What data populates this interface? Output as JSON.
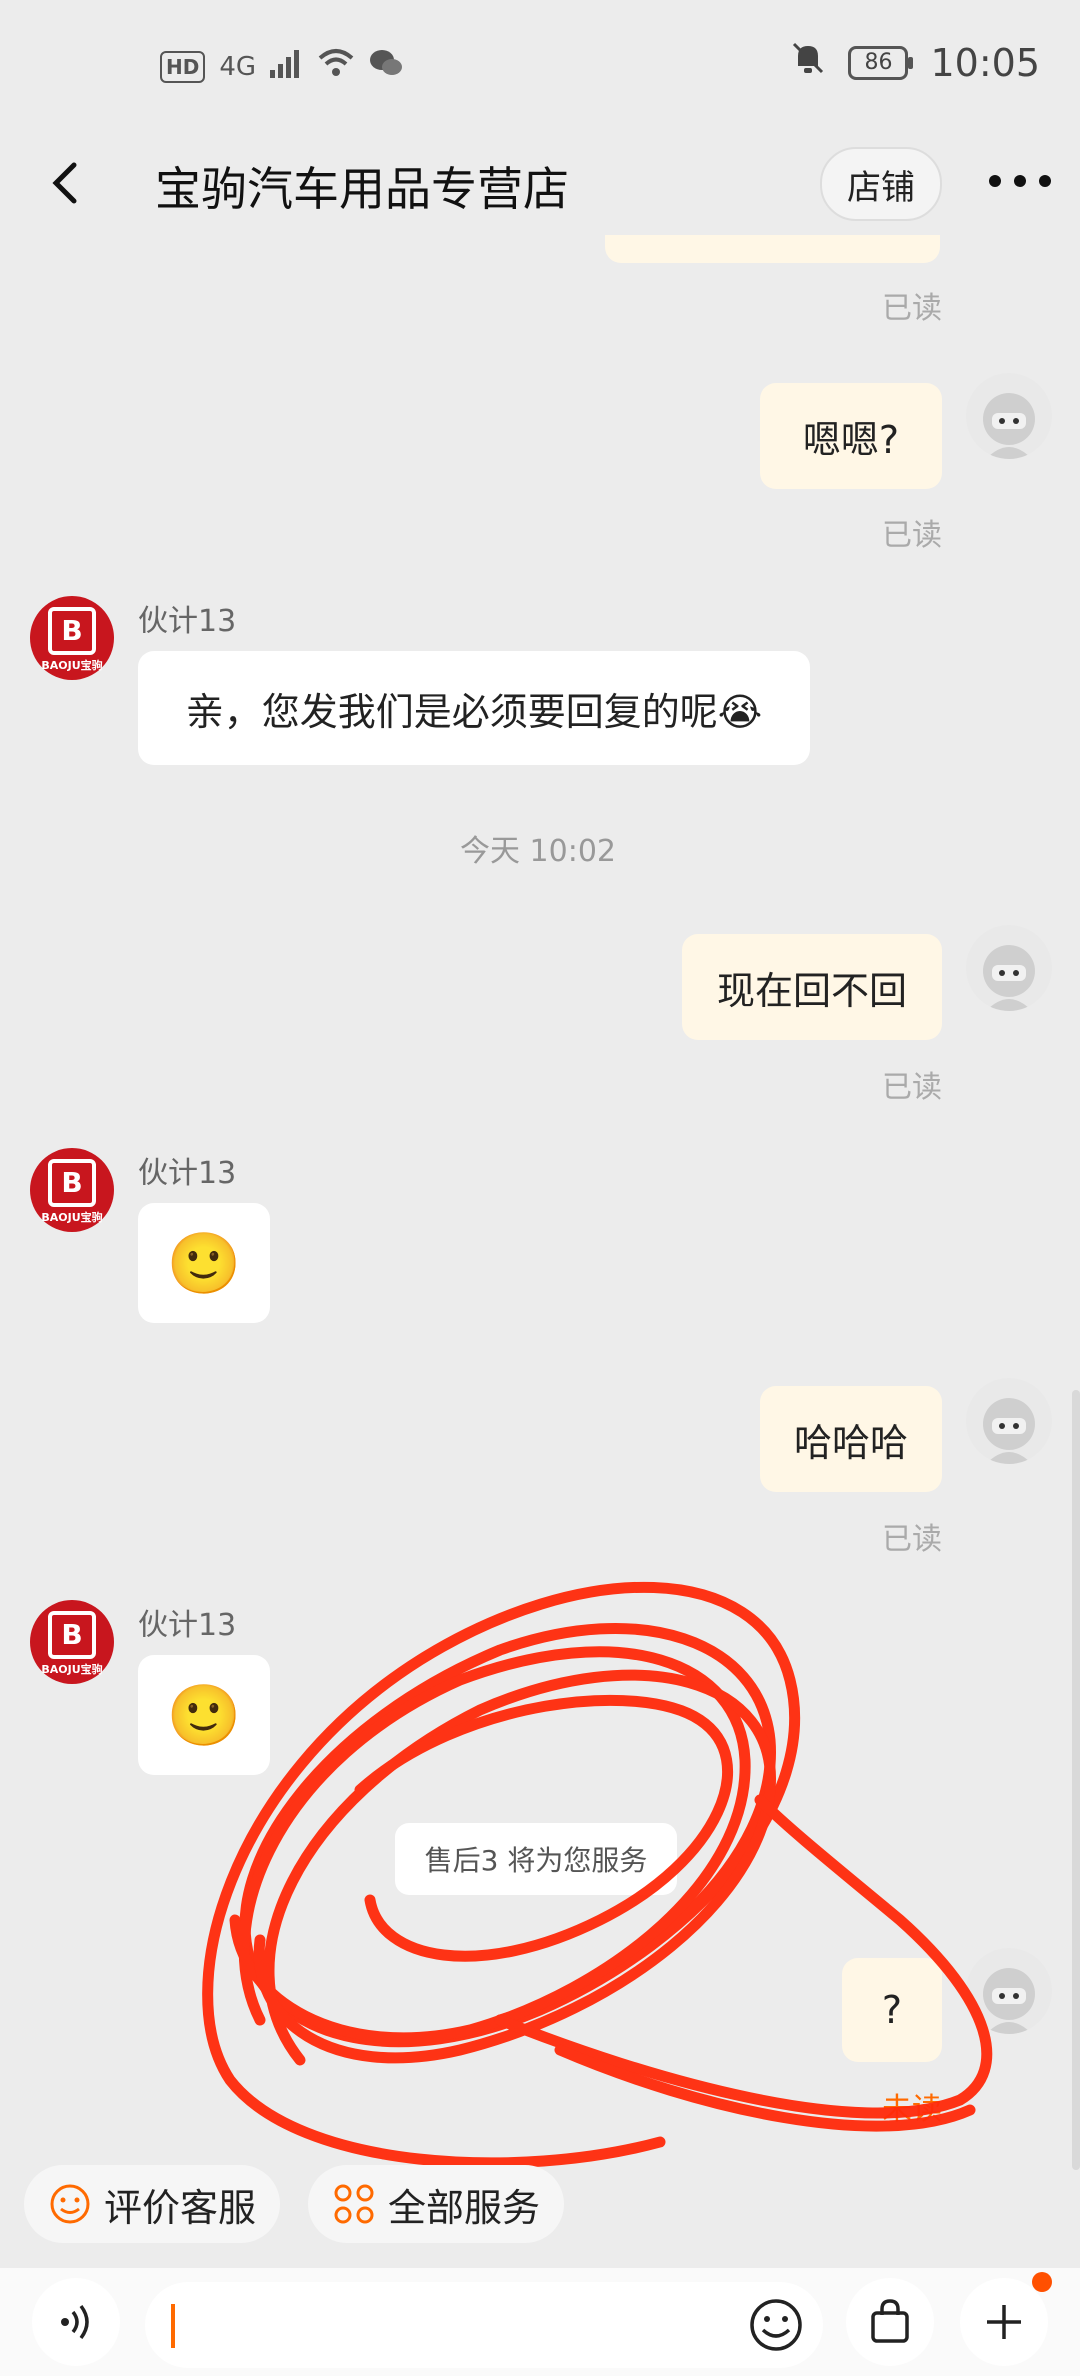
{
  "status_bar": {
    "hd": "HD",
    "network": "4G",
    "battery": "86",
    "time": "10:05"
  },
  "header": {
    "title": "宝驹汽车用品专营店",
    "shop_button": "店铺",
    "more": "•••"
  },
  "messages": {
    "read_label": "已读",
    "unread_label": "未读",
    "m1": "嗯嗯?",
    "sender_name": "伙计13",
    "m2": "亲，您发我们是必须要回复的呢😭",
    "timestamp": "今天  10:02",
    "m3": "现在回不回",
    "m4": "🙂",
    "m5": "哈哈哈",
    "m6": "🙂",
    "system": "售后3 将为您服务",
    "m7": "?"
  },
  "avatars": {
    "shop_logo": "B",
    "shop_text": "BAOJU宝驹"
  },
  "quick_actions": {
    "rate": "评价客服",
    "all_services": "全部服务"
  },
  "input_bar": {
    "placeholder": ""
  },
  "colors": {
    "accent": "#ff6a00",
    "my_bubble": "#fff7e6",
    "shop_avatar": "#c8161e",
    "scribble": "#ff2a0a"
  },
  "icons": [
    "back-arrow-icon",
    "voice-icon",
    "emoji-icon",
    "shopping-bag-icon",
    "plus-icon",
    "smile-icon",
    "services-grid-icon",
    "bell-muted-icon",
    "wifi-icon",
    "signal-icon",
    "wechat-icon"
  ]
}
